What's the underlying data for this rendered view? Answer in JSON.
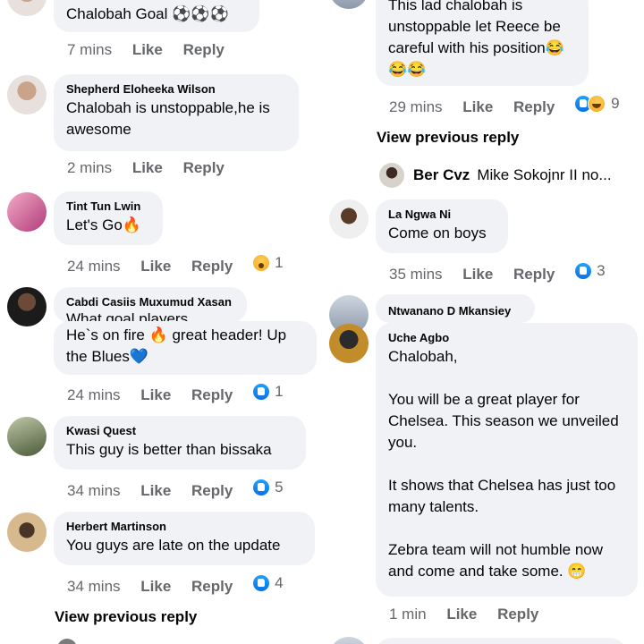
{
  "left": {
    "comments": [
      {
        "text": "Chalobah Goal ⚽⚽⚽",
        "time": "7 mins",
        "like": "Like",
        "reply": "Reply"
      },
      {
        "name": "Shepherd Eloheeka Wilson",
        "text": "Chalobah is unstoppable,he is awesome",
        "time": "2 mins",
        "like": "Like",
        "reply": "Reply"
      },
      {
        "name": "Tint Tun Lwin",
        "text": "Let's Go🔥",
        "time": "24 mins",
        "like": "Like",
        "reply": "Reply",
        "reaction_count": "1",
        "reaction_icon": "wow-icon"
      },
      {
        "name": "Cabdi Casiis Muxumud Xasan",
        "text": "What goal players",
        "time": "",
        "like": "",
        "reply": ""
      },
      {
        "text": "He`s on fire 🔥 great header! Up the Blues💙",
        "time": "24 mins",
        "like": "Like",
        "reply": "Reply",
        "reaction_count": "1",
        "reaction_icon": "like-icon"
      },
      {
        "name": "Kwasi Quest",
        "text": "This guy is better than bissaka",
        "time": "34 mins",
        "like": "Like",
        "reply": "Reply",
        "reaction_count": "5",
        "reaction_icon": "like-icon"
      },
      {
        "name": "Herbert Martinson",
        "text": "You guys are late on the update",
        "time": "34 mins",
        "like": "Like",
        "reply": "Reply",
        "reaction_count": "4",
        "reaction_icon": "like-icon"
      }
    ],
    "view_previous": "View previous reply"
  },
  "right": {
    "comments": [
      {
        "text": "This lad chalobah is unstoppable let Reece be careful with his position😂😂😂",
        "time": "29 mins",
        "like": "Like",
        "reply": "Reply",
        "reaction_count": "9",
        "reaction_icon": "like-haha-icon"
      },
      {
        "name": "La Ngwa Ni",
        "text": "Come on boys",
        "time": "35 mins",
        "like": "Like",
        "reply": "Reply",
        "reaction_count": "3",
        "reaction_icon": "like-icon"
      },
      {
        "name": "Ntwanano D Mkansiey",
        "text": "",
        "time": "",
        "like": "",
        "reply": ""
      },
      {
        "name": "Uche Agbo",
        "text": "Chalobah,\n\nYou will be a great player for Chelsea. This season we unveiled you.\n\nIt shows that Chelsea has just too many talents.\n\nZebra team will not humble now and come and take some. 😁",
        "time": "1 min",
        "like": "Like",
        "reply": "Reply"
      }
    ],
    "view_previous": "View previous reply",
    "reply_preview": {
      "name": "Ber Cvz",
      "text": "Mike Sokojnr II no..."
    }
  }
}
